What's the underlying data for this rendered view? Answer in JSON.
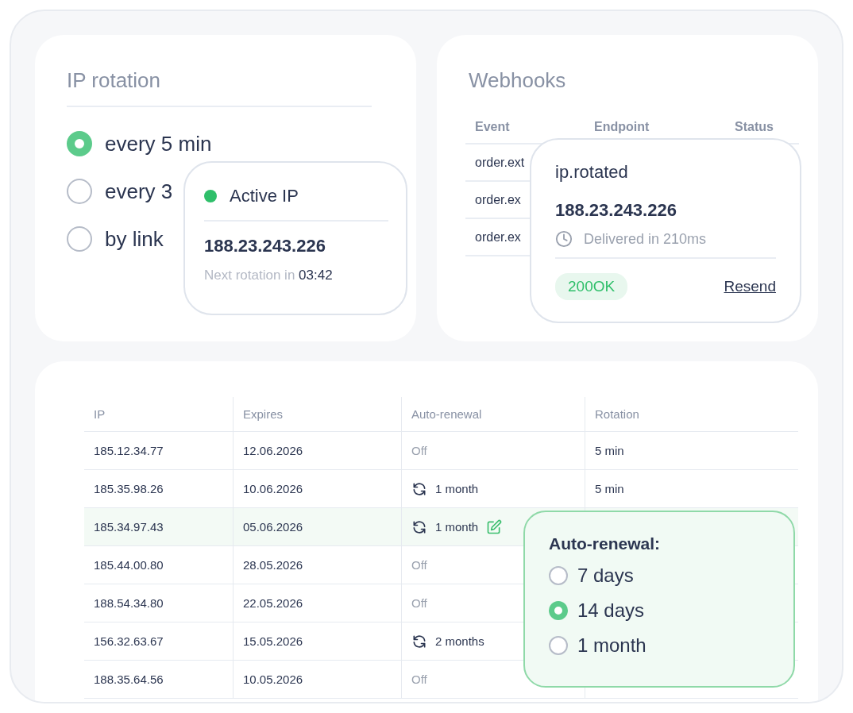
{
  "ip_rotation": {
    "title": "IP rotation",
    "options": [
      {
        "label": "every 5 min",
        "selected": true
      },
      {
        "label": "every 3",
        "selected": false
      },
      {
        "label": "by link",
        "selected": false
      }
    ],
    "active_ip": {
      "label": "Active IP",
      "color": "#2fbf6a",
      "ip": "188.23.243.226",
      "next_label": "Next rotation in",
      "next_time": "03:42"
    }
  },
  "webhooks": {
    "title": "Webhooks",
    "columns": [
      "Event",
      "Endpoint",
      "Status"
    ],
    "rows": [
      {
        "event": "order.ext"
      },
      {
        "event": "order.ex"
      },
      {
        "event": "order.ex"
      }
    ],
    "popup": {
      "event": "ip.rotated",
      "ip": "188.23.243.226",
      "delivered": "Delivered in 210ms",
      "status": "200OK",
      "action": "Resend"
    }
  },
  "table": {
    "columns": [
      "IP",
      "Expires",
      "Auto-renewal",
      "Rotation"
    ],
    "rows": [
      {
        "ip": "185.12.34.77",
        "expires": "12.06.2026",
        "renewal": {
          "kind": "off",
          "text": "Off"
        },
        "rotation": "5 min",
        "selected": false
      },
      {
        "ip": "185.35.98.26",
        "expires": "10.06.2026",
        "renewal": {
          "kind": "on",
          "text": "1 month"
        },
        "rotation": "5 min",
        "selected": false
      },
      {
        "ip": "185.34.97.43",
        "expires": "05.06.2026",
        "renewal": {
          "kind": "on",
          "text": "1 month"
        },
        "selected": true
      },
      {
        "ip": "185.44.00.80",
        "expires": "28.05.2026",
        "renewal": {
          "kind": "off",
          "text": "Off"
        },
        "selected": false
      },
      {
        "ip": "188.54.34.80",
        "expires": "22.05.2026",
        "renewal": {
          "kind": "off",
          "text": "Off"
        },
        "selected": false
      },
      {
        "ip": "156.32.63.67",
        "expires": "15.05.2026",
        "renewal": {
          "kind": "on",
          "text": "2 months"
        },
        "selected": false
      },
      {
        "ip": "188.35.64.56",
        "expires": "10.05.2026",
        "renewal": {
          "kind": "off",
          "text": "Off"
        },
        "selected": false
      }
    ],
    "renewal_popup": {
      "title": "Auto-renewal:",
      "options": [
        {
          "label": "7 days",
          "selected": false
        },
        {
          "label": "14 days",
          "selected": true
        },
        {
          "label": "1 month",
          "selected": false
        }
      ]
    }
  }
}
